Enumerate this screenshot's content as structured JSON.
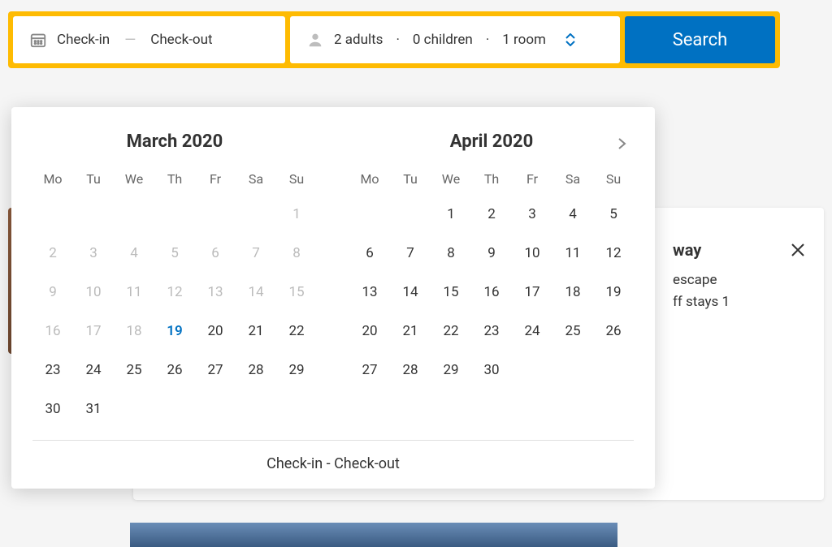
{
  "searchbar": {
    "checkin_label": "Check-in",
    "checkout_label": "Check-out",
    "guests_summary": {
      "adults": "2 adults",
      "children": "0 children",
      "rooms": "1 room"
    },
    "search_label": "Search"
  },
  "datepicker": {
    "weekday_labels": [
      "Mo",
      "Tu",
      "We",
      "Th",
      "Fr",
      "Sa",
      "Su"
    ],
    "months": [
      {
        "title": "March 2020",
        "lead_blanks": 6,
        "days": [
          {
            "d": 1,
            "dim": true
          },
          {
            "d": 2,
            "dim": true
          },
          {
            "d": 3,
            "dim": true
          },
          {
            "d": 4,
            "dim": true
          },
          {
            "d": 5,
            "dim": true
          },
          {
            "d": 6,
            "dim": true
          },
          {
            "d": 7,
            "dim": true
          },
          {
            "d": 8,
            "dim": true
          },
          {
            "d": 9,
            "dim": true
          },
          {
            "d": 10,
            "dim": true
          },
          {
            "d": 11,
            "dim": true
          },
          {
            "d": 12,
            "dim": true
          },
          {
            "d": 13,
            "dim": true
          },
          {
            "d": 14,
            "dim": true
          },
          {
            "d": 15,
            "dim": true
          },
          {
            "d": 16,
            "dim": true
          },
          {
            "d": 17,
            "dim": true
          },
          {
            "d": 18,
            "dim": true
          },
          {
            "d": 19,
            "today": true
          },
          {
            "d": 20
          },
          {
            "d": 21
          },
          {
            "d": 22
          },
          {
            "d": 23
          },
          {
            "d": 24
          },
          {
            "d": 25
          },
          {
            "d": 26
          },
          {
            "d": 27
          },
          {
            "d": 28
          },
          {
            "d": 29
          },
          {
            "d": 30
          },
          {
            "d": 31
          }
        ]
      },
      {
        "title": "April 2020",
        "lead_blanks": 2,
        "days": [
          {
            "d": 1
          },
          {
            "d": 2
          },
          {
            "d": 3
          },
          {
            "d": 4
          },
          {
            "d": 5
          },
          {
            "d": 6
          },
          {
            "d": 7
          },
          {
            "d": 8
          },
          {
            "d": 9
          },
          {
            "d": 10
          },
          {
            "d": 11
          },
          {
            "d": 12
          },
          {
            "d": 13
          },
          {
            "d": 14
          },
          {
            "d": 15
          },
          {
            "d": 16
          },
          {
            "d": 17
          },
          {
            "d": 18
          },
          {
            "d": 19
          },
          {
            "d": 20
          },
          {
            "d": 21
          },
          {
            "d": 22
          },
          {
            "d": 23
          },
          {
            "d": 24
          },
          {
            "d": 25
          },
          {
            "d": 26
          },
          {
            "d": 27
          },
          {
            "d": 28
          },
          {
            "d": 29
          },
          {
            "d": 30
          }
        ]
      }
    ],
    "footer": "Check-in - Check-out"
  },
  "promo": {
    "title_fragment": "way",
    "line1_fragment": "escape",
    "line2_fragment": "ff stays 1"
  }
}
